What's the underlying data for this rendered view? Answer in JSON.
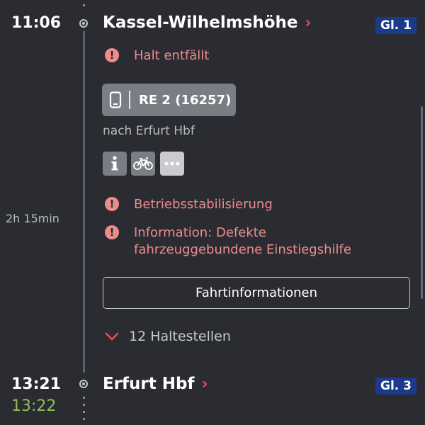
{
  "departure": {
    "time": "11:06",
    "station": "Kassel-Wilhelmshöhe",
    "platform": "Gl. 1",
    "notice": "Halt entfällt"
  },
  "train": {
    "name": "RE 2 (16257)",
    "direction": "nach Erfurt Hbf",
    "duration": "2h 15min",
    "notices": [
      "Betriebsstabilisierung",
      "Information: Defekte",
      "fahrzeuggebundene Einstiegshilfe"
    ],
    "trip_info_button": "Fahrtinformationen",
    "stops_label": "12 Haltestellen"
  },
  "arrival": {
    "time": "13:21",
    "actual_time": "13:22",
    "station": "Erfurt Hbf",
    "platform": "Gl. 3"
  },
  "colors": {
    "background": "#2a2c32",
    "warning": "#ee8c8c",
    "accent_red": "#ec4c55",
    "platform_blue": "#1c3a8c",
    "on_time_green": "#8fbf5a"
  },
  "icons": [
    "info-icon",
    "bicycle-icon",
    "more-icon",
    "phone-icon",
    "warning-icon",
    "chevron-right-icon",
    "chevron-down-icon"
  ]
}
